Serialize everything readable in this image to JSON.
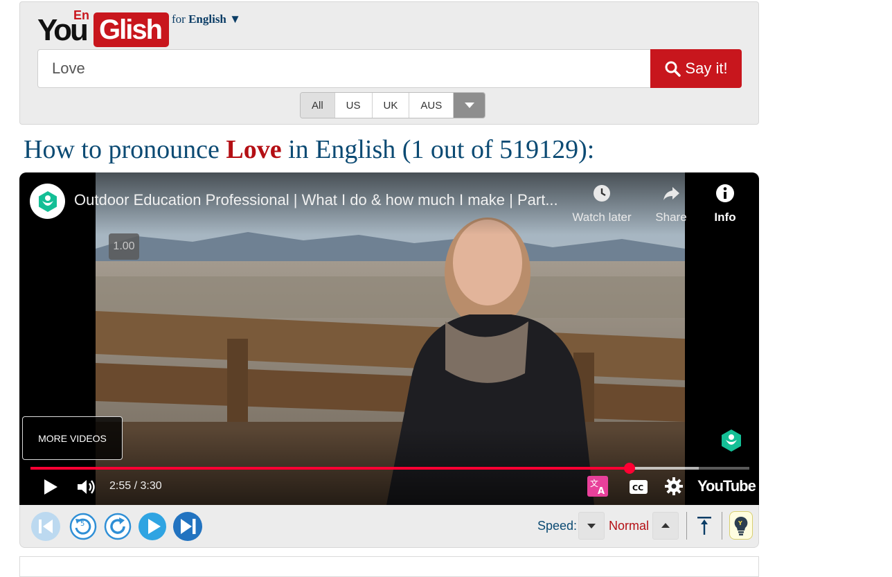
{
  "header": {
    "logo": {
      "you": "You",
      "en": "En",
      "glish": "Glish"
    },
    "language_prefix": "for",
    "language": "English",
    "language_caret": "▼"
  },
  "search": {
    "value": "Love",
    "placeholder": ""
  },
  "say_button": {
    "label": "Say it!"
  },
  "accents": {
    "selected": "All",
    "items": [
      "All",
      "US",
      "UK",
      "AUS"
    ]
  },
  "result": {
    "prefix": "How to pronounce ",
    "word": "Love",
    "suffix": " in English (1 out of 519129):"
  },
  "player": {
    "video_title": "Outdoor Education Professional | What I do & how much I make | Part...",
    "watch_later": "Watch later",
    "share": "Share",
    "info": "Info",
    "speed_badge": "1.00",
    "more_videos": "MORE VIDEOS",
    "time_current": "2:55",
    "time_total": "3:30",
    "time_display": "2:55 / 3:30",
    "progress_fraction": 0.833,
    "buffered_fraction": 0.93,
    "youtube_logo": "YouTube",
    "accent_color": "#ff0033",
    "icons": [
      "channel-avatar-icon",
      "clock-icon",
      "share-arrow-icon",
      "info-icon",
      "play-icon",
      "volume-icon",
      "translate-icon",
      "captions-icon",
      "gear-icon"
    ]
  },
  "controls": {
    "speed_label": "Speed:",
    "speed_value": "Normal",
    "icons": [
      "skip-start-icon",
      "replay-5-icon",
      "repeat-icon",
      "play-icon",
      "next-icon",
      "speed-down-icon",
      "speed-up-icon",
      "back-to-top-icon",
      "lightbulb-icon"
    ]
  },
  "colors": {
    "brand_red": "#c8161d",
    "heading_blue": "#0b4a73",
    "button_blue": "#2f8fd6"
  }
}
